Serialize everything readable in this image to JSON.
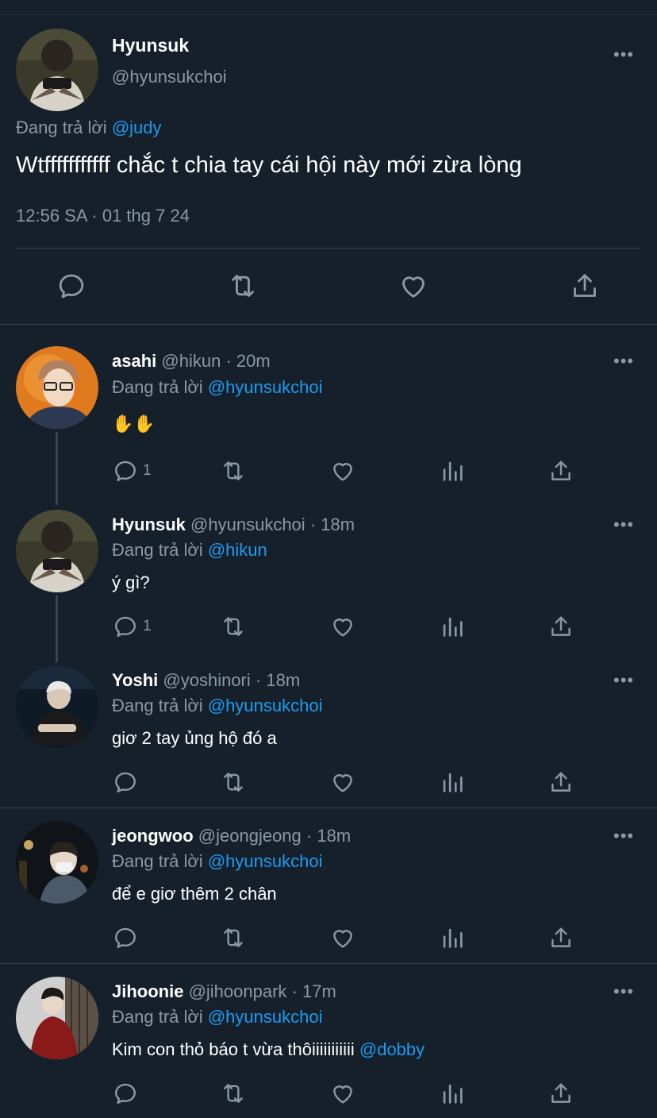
{
  "main_tweet": {
    "author_name": "Hyunsuk",
    "author_handle": "@hyunsukchoi",
    "replying_label": "Đang trả lời",
    "replying_to": "@judy",
    "text": "Wtfffffffffff chắc t chia tay cái hội này mới zừa lòng",
    "timestamp": "12:56 SA · 01 thg 7 24"
  },
  "replies": [
    {
      "author_name": "asahi",
      "author_handle": "@hikun",
      "time": "· 20m",
      "replying_label": "Đang trả lời",
      "replying_to": "@hyunsukchoi",
      "text": "✋✋",
      "reply_count": "1"
    },
    {
      "author_name": "Hyunsuk",
      "author_handle": "@hyunsukchoi",
      "time": "· 18m",
      "replying_label": "Đang trả lời",
      "replying_to": "@hikun",
      "text": "ý gì?",
      "reply_count": "1"
    },
    {
      "author_name": "Yoshi",
      "author_handle": "@yoshinori",
      "time": "· 18m",
      "replying_label": "Đang trả lời",
      "replying_to": "@hyunsukchoi",
      "text": "giơ 2 tay ủng hộ đó a",
      "reply_count": ""
    },
    {
      "author_name": "jeongwoo",
      "author_handle": "@jeongjeong",
      "time": "· 18m",
      "replying_label": "Đang trả lời",
      "replying_to": "@hyunsukchoi",
      "text": "để e giơ thêm 2 chân",
      "reply_count": ""
    },
    {
      "author_name": "Jihoonie",
      "author_handle": "@jihoonpark",
      "time": "· 17m",
      "replying_label": "Đang trả lời",
      "replying_to": "@hyunsukchoi",
      "text": "Kim con thỏ báo t vừa thôiiiiiiiiiii",
      "mention": "@dobby",
      "reply_count": ""
    }
  ],
  "icons": {
    "reply": "reply-icon",
    "retweet": "retweet-icon",
    "like": "heart-icon",
    "views": "analytics-icon",
    "share": "share-icon",
    "more": "more-icon"
  },
  "colors": {
    "background": "#15202b",
    "link": "#1d9bf0",
    "muted": "#8b98a5",
    "divider": "#38444d"
  }
}
